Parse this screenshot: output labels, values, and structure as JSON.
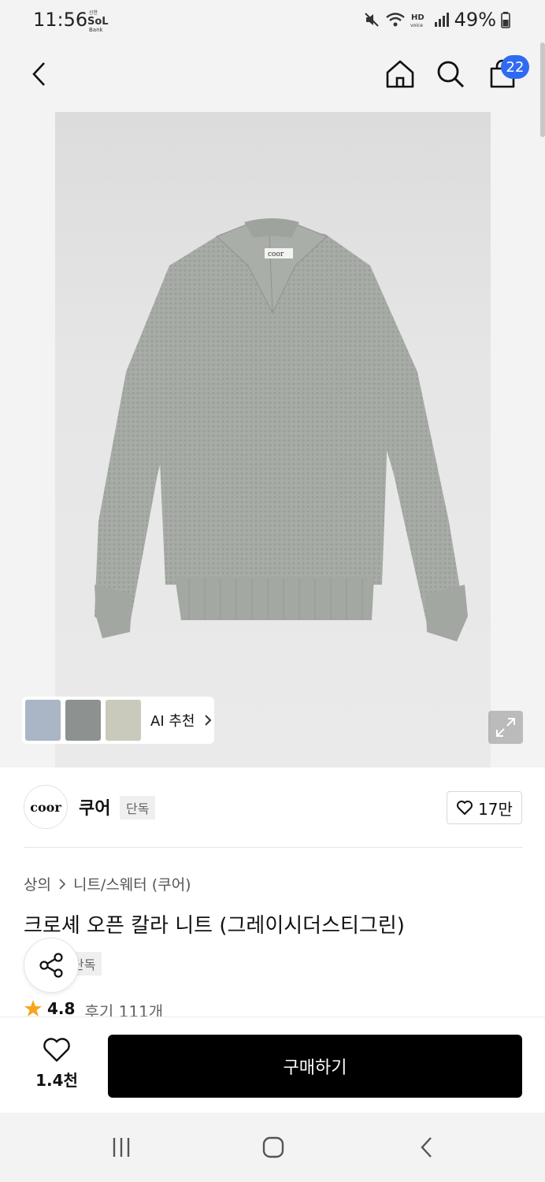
{
  "status": {
    "time": "11:56",
    "battery": "49%",
    "icons": [
      "sol-bank-icon",
      "mute-icon",
      "wifi-icon",
      "hd-voice-icon",
      "signal-icon",
      "battery-icon"
    ]
  },
  "nav": {
    "cart_count": "22",
    "icons": [
      "back-arrow-icon",
      "home-icon",
      "search-icon",
      "cart-icon"
    ]
  },
  "ai_recommend": {
    "label": "AI 추천"
  },
  "brand": {
    "logo_text": "coor",
    "name": "쿠어",
    "exclusive_tag": "단독",
    "likes": "17만"
  },
  "product": {
    "breadcrumb": [
      "상의",
      "니트/스웨터 (쿠어)"
    ],
    "title": "크로셰 오픈 칼라 니트 (그레이시더스티그린)",
    "exclusive_tag": "단독",
    "rating": "4.8",
    "review_label": "후기 111개"
  },
  "bottom": {
    "wish_count": "1.4천",
    "buy_label": "구매하기"
  },
  "colors": {
    "accent_blue": "#2f6bf2",
    "star": "#f7a51c",
    "buy_button": "#000000"
  }
}
